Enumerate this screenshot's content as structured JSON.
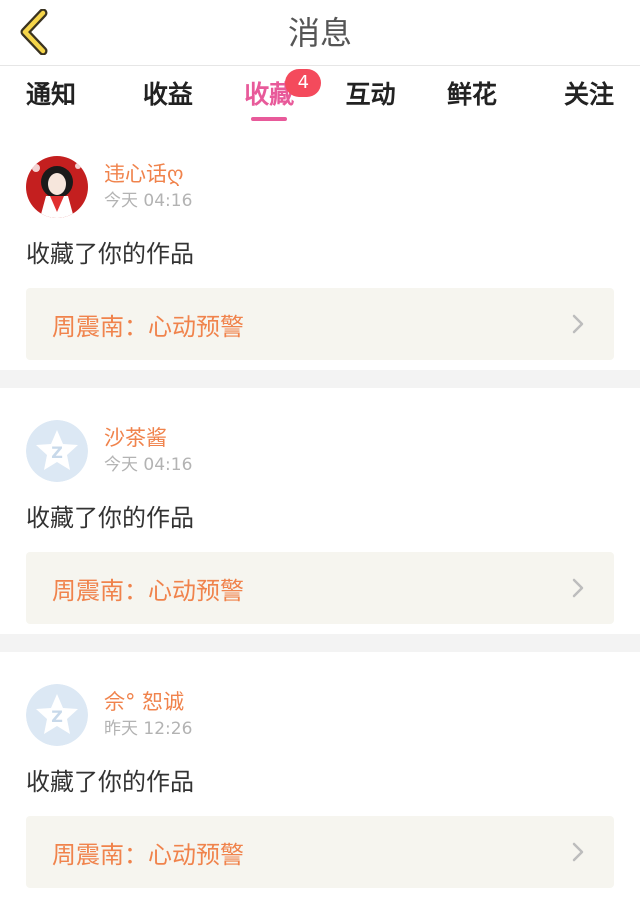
{
  "header": {
    "title": "消息"
  },
  "tabs": [
    {
      "label": "通知"
    },
    {
      "label": "收益"
    },
    {
      "label": "收藏",
      "badge": "4",
      "active": true
    },
    {
      "label": "互动"
    },
    {
      "label": "鲜花"
    },
    {
      "label": "关注"
    }
  ],
  "messages": [
    {
      "username": "违心话ღ",
      "time": "今天 04:16",
      "action": "收藏了你的作品",
      "work": "周震南：心动预警"
    },
    {
      "username": "沙茶酱",
      "time": "今天 04:16",
      "action": "收藏了你的作品",
      "work": "周震南：心动预警"
    },
    {
      "username": "佘° 恕诚",
      "time": "昨天 12:26",
      "action": "收藏了你的作品",
      "work": "周震南：心动预警"
    }
  ],
  "colors": {
    "accent": "#e85a9a",
    "badge": "#f44a5c",
    "username": "#f0834c",
    "card_bg": "#f6f5ef"
  },
  "icons": {
    "back": "chevron-left-icon",
    "arrow": "chevron-right-icon"
  }
}
